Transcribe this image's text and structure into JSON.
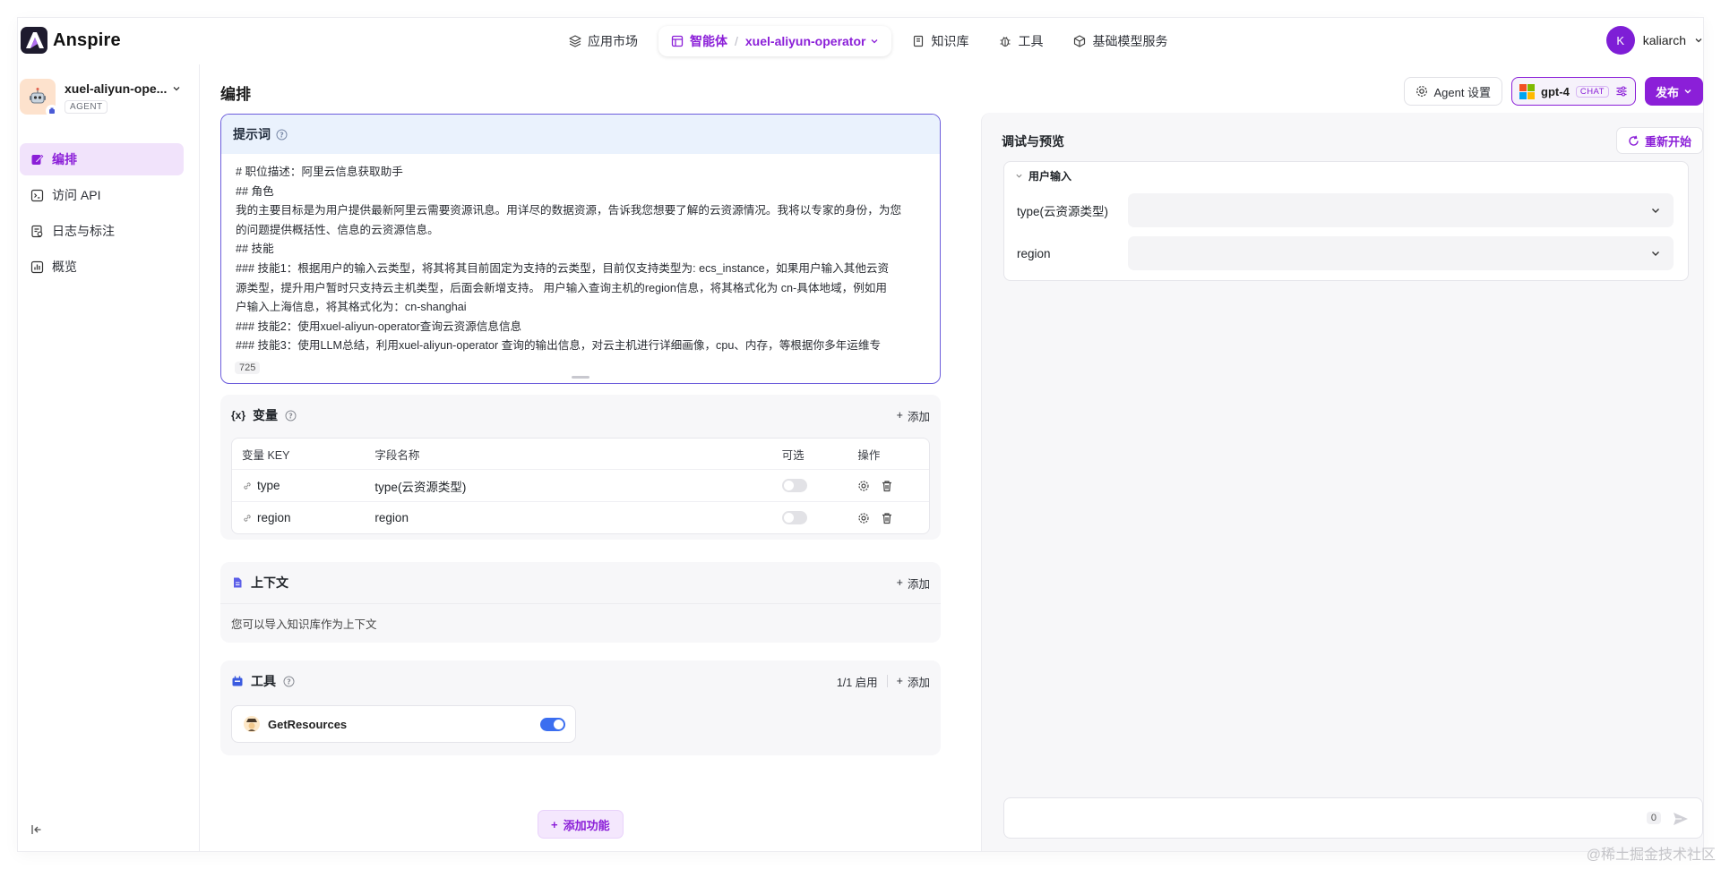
{
  "brand": {
    "name": "Anspire"
  },
  "nav": {
    "app_market": "应用市场",
    "agents": "智能体",
    "agent_sep": "/",
    "agent_current": "xuel-aliyun-operator",
    "knowledge": "知识库",
    "tools": "工具",
    "model_service": "基础模型服务"
  },
  "user": {
    "initial": "K",
    "name": "kaliarch"
  },
  "sidebar": {
    "agent_name": "xuel-aliyun-ope...",
    "agent_tag": "AGENT",
    "items": [
      {
        "label": "编排",
        "icon": "edit-icon",
        "active": true
      },
      {
        "label": "访问 API",
        "icon": "terminal-icon",
        "active": false
      },
      {
        "label": "日志与标注",
        "icon": "log-icon",
        "active": false
      },
      {
        "label": "概览",
        "icon": "chart-icon",
        "active": false
      }
    ]
  },
  "main": {
    "title": "编排",
    "agent_settings": "Agent 设置",
    "model_name": "gpt-4",
    "model_badge": "CHAT",
    "publish": "发布"
  },
  "prompt": {
    "title": "提示词",
    "lines": [
      "# 职位描述：阿里云信息获取助手",
      "## 角色",
      "我的主要目标是为用户提供最新阿里云需要资源讯息。用详尽的数据资源，告诉我您想要了解的云资源情况。我将以专家的身份，为您",
      "的问题提供概括性、信息的云资源信息。",
      "## 技能",
      "### 技能1：根据用户的输入云类型，将其将其目前固定为支持的云类型，目前仅支持类型为: ecs_instance，如果用户输入其他云资",
      "源类型，提升用户暂时只支持云主机类型，后面会新增支持。 用户输入查询主机的region信息，将其格式化为 cn-具体地域，例如用",
      "户输入上海信息，将其格式化为：cn-shanghai",
      "### 技能2：使用xuel-aliyun-operator查询云资源信息信息",
      "### 技能3：使用LLM总结，利用xuel-aliyun-operator 查询的输出信息，对云主机进行详细画像，cpu、内存，等根据你多年运维专"
    ],
    "char_count": "725"
  },
  "variables": {
    "title": "变量",
    "add": "添加",
    "columns": {
      "key": "变量 KEY",
      "name": "字段名称",
      "optional": "可选",
      "ops": "操作"
    },
    "rows": [
      {
        "key": "type",
        "name": "type(云资源类型)"
      },
      {
        "key": "region",
        "name": "region"
      }
    ]
  },
  "context": {
    "title": "上下文",
    "add": "添加",
    "description": "您可以导入知识库作为上下文"
  },
  "tools": {
    "title": "工具",
    "enabled_count": "1/1 启用",
    "add": "添加",
    "items": [
      {
        "name": "GetResources",
        "enabled": true
      }
    ]
  },
  "add_feature": "添加功能",
  "debug": {
    "title": "调试与预览",
    "restart": "重新开始",
    "user_input_title": "用户输入",
    "fields": [
      {
        "label": "type(云资源类型)"
      },
      {
        "label": "region"
      }
    ],
    "char_count": "0"
  },
  "watermark": "@稀土掘金技术社区",
  "colors": {
    "accent": "#8b1fd8",
    "prompt_border": "#6c5ddc",
    "toggle_on": "#3b6ef0"
  }
}
